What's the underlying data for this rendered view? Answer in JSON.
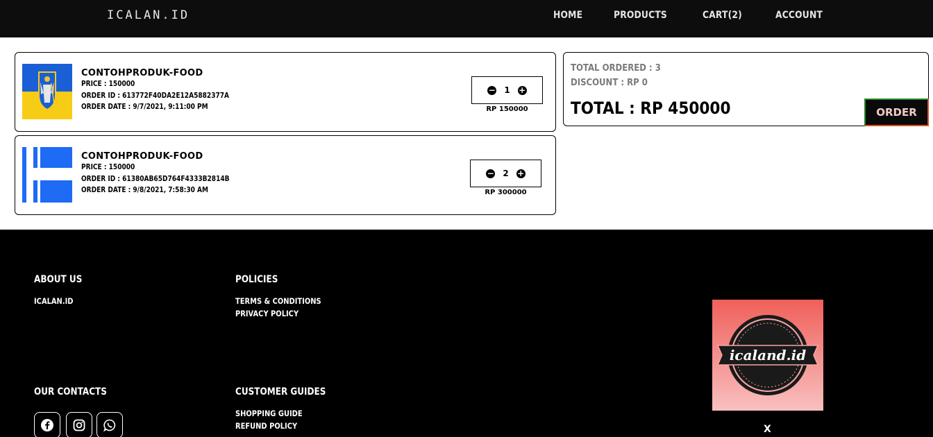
{
  "nav": {
    "logo": "ICALAN.ID",
    "links": [
      "HOME",
      "PRODUCTS",
      "CART(2)",
      "ACCOUNT"
    ]
  },
  "cart_items": [
    {
      "name": "CONTOHPRODUK-FOOD",
      "price": "PRICE : 150000",
      "order_id": "ORDER ID : 613772F40DA2E12A5882377A",
      "order_date": "ORDER DATE : 9/7/2021, 9:11:00 PM",
      "qty": "1",
      "subtotal": "RP 150000",
      "flag_icon": "ukraine-coat-of-arms-flag"
    },
    {
      "name": "CONTOHPRODUK-FOOD",
      "price": "PRICE : 150000",
      "order_id": "ORDER ID : 61380AB65D764F4333B2814B",
      "order_date": "ORDER DATE : 9/8/2021, 7:58:30 AM",
      "qty": "2",
      "subtotal": "RP 300000",
      "flag_icon": "blue-white-cross-flag"
    }
  ],
  "summary": {
    "total_ordered": "TOTAL ORDERED : 3",
    "discount": "DISCOUNT : RP 0",
    "total": "TOTAL : RP 450000",
    "order_button": "ORDER"
  },
  "footer": {
    "about_heading": "ABOUT US",
    "about_link": "ICALAN.ID",
    "policies_heading": "POLICIES",
    "policy_links": [
      "TERMS & CONDITIONS",
      "PRIVACY POLICY"
    ],
    "contacts_heading": "OUR CONTACTS",
    "guides_heading": "CUSTOMER GUIDES",
    "guide_links": [
      "SHOPPING GUIDE",
      "REFUND POLICY"
    ],
    "social_icons": [
      "facebook-icon",
      "instagram-icon",
      "whatsapp-icon"
    ],
    "logo_text": "icaland.id",
    "close_label": "X"
  },
  "colors": {
    "nav_bg": "#0d0d0d",
    "footer_bg": "#000000",
    "order_btn_text": "#f6c9c9",
    "logo_bg_top": "#f0605a",
    "logo_bg_bottom": "#f8c0c0"
  }
}
